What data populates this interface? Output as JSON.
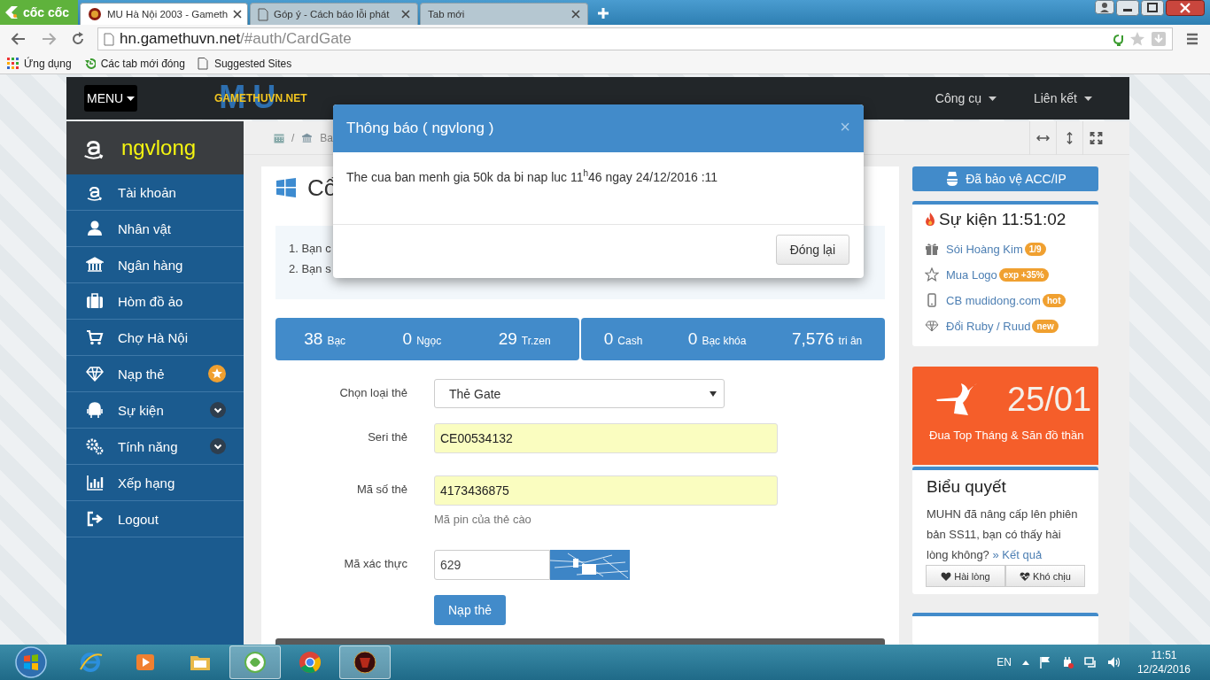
{
  "browser": {
    "brand": "cốc cốc",
    "tabs": [
      {
        "title": "MU Hà Nội 2003 - Gameth",
        "selected": true
      },
      {
        "title": "Góp ý - Cách báo lỗi phát",
        "selected": false
      },
      {
        "title": "Tab mới",
        "selected": false
      }
    ],
    "url_host": "hn.gamethuvn.net",
    "url_path": "/#auth/CardGate",
    "bookmarks": [
      "Ứng dụng",
      "Các tab mới đóng",
      "Suggested Sites"
    ]
  },
  "navbar": {
    "menu": "MENU",
    "logo": {
      "backdrop": "MU",
      "text": "GAMETHUVN.NET"
    },
    "links": [
      "Công cụ",
      "Liên kết"
    ]
  },
  "sidebar": {
    "user": "ngvlong",
    "items": [
      {
        "label": "Tài khoản",
        "kind": "plain"
      },
      {
        "label": "Nhân vật",
        "kind": "plain"
      },
      {
        "label": "Ngân hàng",
        "kind": "plain"
      },
      {
        "label": "Hòm đồ ảo",
        "kind": "plain"
      },
      {
        "label": "Chợ Hà Nội",
        "kind": "plain"
      },
      {
        "label": "Nạp thẻ",
        "kind": "starred"
      },
      {
        "label": "Sự kiện",
        "kind": "expandable",
        "expanded": false
      },
      {
        "label": "Tính năng",
        "kind": "expandable",
        "expanded": false
      },
      {
        "label": "Xếp hạng",
        "kind": "plain"
      },
      {
        "label": "Logout",
        "kind": "plain"
      }
    ]
  },
  "breadcrumb": {
    "separator": "/",
    "current": "Ba"
  },
  "card": {
    "title": "Cổ",
    "notes": [
      "1. Bạn c",
      "2. Bạn s"
    ],
    "stats": [
      [
        {
          "value": "38",
          "unit": "Bạc"
        },
        {
          "value": "0",
          "unit": "Ngọc"
        },
        {
          "value": "29",
          "unit": "Tr.zen"
        }
      ],
      [
        {
          "value": "0",
          "unit": "Cash"
        },
        {
          "value": "0",
          "unit": "Bạc khóa"
        },
        {
          "value": "7,576",
          "unit": "tri ân"
        }
      ]
    ],
    "fields": [
      {
        "kind": "select",
        "label": "Chọn loại thẻ",
        "value": "Thẻ Gate"
      },
      {
        "kind": "text",
        "label": "Seri thẻ",
        "value": "CE00534132",
        "autofilled": true
      },
      {
        "kind": "text",
        "label": "Mã số thẻ",
        "value": "4173436875",
        "autofilled": true,
        "help": "Mã pin của thẻ cào"
      },
      {
        "kind": "captcha",
        "label": "Mã xác thực",
        "value": "629"
      }
    ],
    "submit": "Nạp thẻ"
  },
  "right": {
    "protect": "Đã bảo vệ ACC/IP",
    "events": {
      "title": "Sự kiện 11:51:02",
      "items": [
        {
          "label": "Sói Hoàng Kim",
          "badge": "1/9"
        },
        {
          "label": "Mua Logo",
          "badge": "exp +35%"
        },
        {
          "label": "CB mudidong.com",
          "badge": "hot"
        },
        {
          "label": "Đổi Ruby / Ruud",
          "badge": "new"
        }
      ]
    },
    "banner": {
      "date": "25/01",
      "text": "Đua Top Tháng & Săn đồ thần"
    },
    "vote": {
      "title": "Biểu quyết",
      "question": "MUHN đã nâng cấp lên phiên bản SS11, bạn có thấy hài lòng không?",
      "result_link": "» Kết quả",
      "buttons": [
        "Hài lòng",
        "Khó chịu"
      ]
    }
  },
  "modal": {
    "title": "Thông báo ( ngvlong )",
    "close": "×",
    "message": "The cua ban menh gia 50k da bi nap luc 11$^{h}$46 ngay 24/12/2016 :11",
    "button": "Đóng lại"
  },
  "taskbar": {
    "apps": [
      {
        "running": false
      },
      {
        "running": false
      },
      {
        "running": false
      },
      {
        "running": true
      },
      {
        "running": false
      },
      {
        "running": true
      }
    ],
    "lang": "EN",
    "time": "11:51",
    "date": "12/24/2016"
  }
}
